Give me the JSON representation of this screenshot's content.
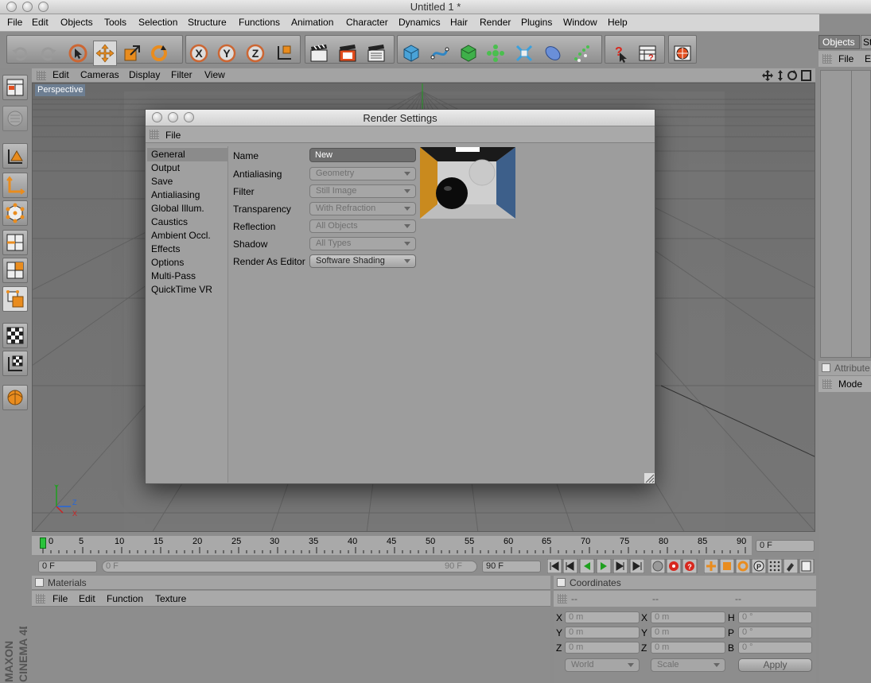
{
  "window": {
    "title": "Untitled 1 *"
  },
  "menu": [
    "File",
    "Edit",
    "Objects",
    "Tools",
    "Selection",
    "Structure",
    "Functions",
    "Animation",
    "Character",
    "Dynamics",
    "Hair",
    "Render",
    "Plugins",
    "Window",
    "Help"
  ],
  "viewport": {
    "menu": [
      "Edit",
      "Cameras",
      "Display",
      "Filter",
      "View"
    ],
    "label": "Perspective",
    "axes": {
      "y": "Y",
      "z": "Z",
      "x": "X"
    }
  },
  "right_panel": {
    "tabs": [
      "Objects",
      "St"
    ],
    "menu": [
      "File",
      "E"
    ],
    "attributes_label": "Attribute",
    "mode_label": "Mode"
  },
  "render_dialog": {
    "title": "Render Settings",
    "menu": "File",
    "nav": [
      "General",
      "Output",
      "Save",
      "Antialiasing",
      "Global Illum.",
      "Caustics",
      "Ambient Occl.",
      "Effects",
      "Options",
      "Multi-Pass",
      "QuickTime VR"
    ],
    "selected_nav": "General",
    "fields": {
      "name": {
        "label": "Name",
        "value": "New"
      },
      "antialiasing": {
        "label": "Antialiasing",
        "value": "Geometry"
      },
      "filter": {
        "label": "Filter",
        "value": "Still Image"
      },
      "transparency": {
        "label": "Transparency",
        "value": "With Refraction"
      },
      "reflection": {
        "label": "Reflection",
        "value": "All Objects"
      },
      "shadow": {
        "label": "Shadow",
        "value": "All Types"
      },
      "render_as_editor": {
        "label": "Render As Editor",
        "value": "Software Shading"
      }
    }
  },
  "timeline": {
    "ticks": [
      "0",
      "5",
      "10",
      "15",
      "20",
      "25",
      "30",
      "35",
      "40",
      "45",
      "50",
      "55",
      "60",
      "65",
      "70",
      "75",
      "80",
      "85",
      "90"
    ],
    "current_field": "0 F"
  },
  "time_controls": {
    "start": "0 F",
    "range_start": "0 F",
    "range_end": "90 F",
    "end": "90 F"
  },
  "materials": {
    "title": "Materials",
    "menu": [
      "File",
      "Edit",
      "Function",
      "Texture"
    ]
  },
  "coordinates": {
    "title": "Coordinates",
    "headers": [
      "--",
      "--",
      "--"
    ],
    "rows": [
      {
        "a_label": "X",
        "a_value": "0 m",
        "b_label": "X",
        "b_value": "0 m",
        "c_label": "H",
        "c_value": "0 °"
      },
      {
        "a_label": "Y",
        "a_value": "0 m",
        "b_label": "Y",
        "b_value": "0 m",
        "c_label": "P",
        "c_value": "0 °"
      },
      {
        "a_label": "Z",
        "a_value": "0 m",
        "b_label": "Z",
        "b_value": "0 m",
        "c_label": "B",
        "c_value": "0 °"
      }
    ],
    "world": "World",
    "scale": "Scale",
    "apply": "Apply"
  },
  "brand": "MAXON CINEMA 4D"
}
